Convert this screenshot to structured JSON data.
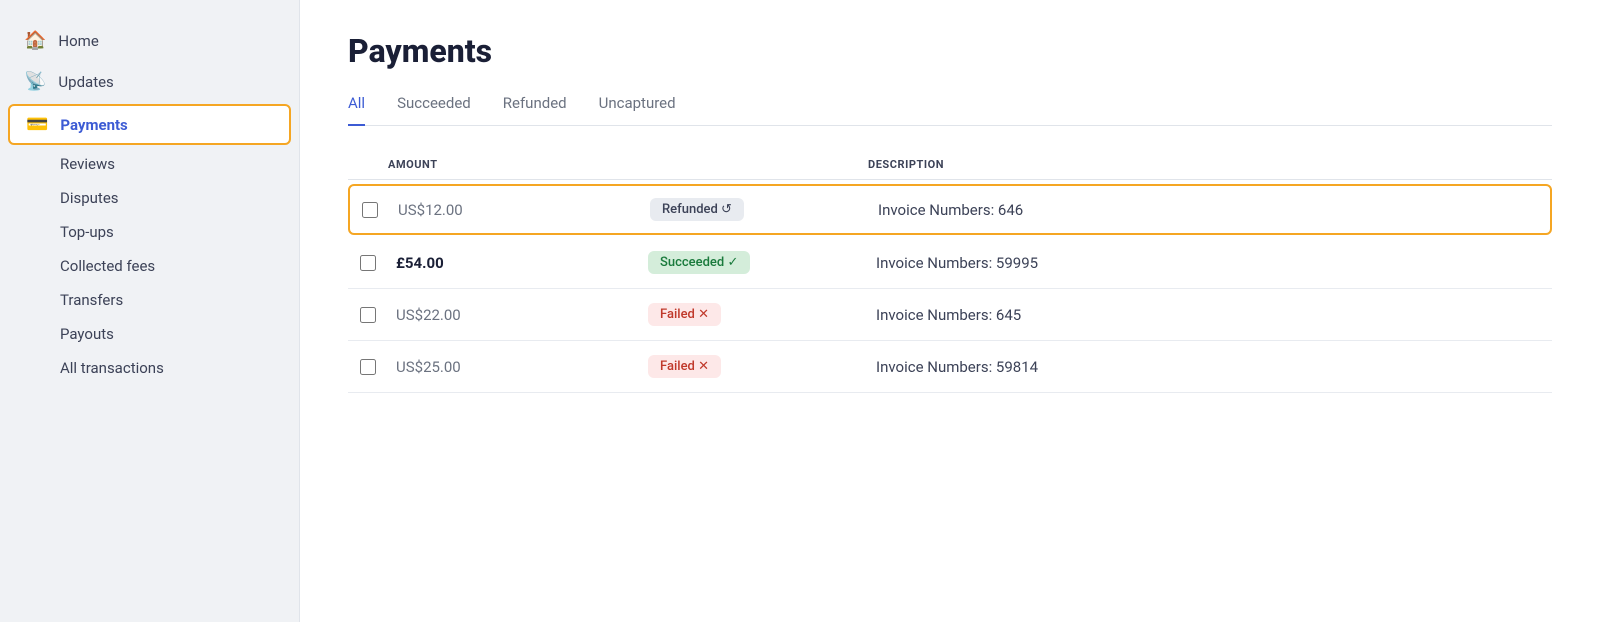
{
  "sidebar": {
    "items": [
      {
        "id": "home",
        "label": "Home",
        "icon": "🏠",
        "active": false,
        "sub": false
      },
      {
        "id": "updates",
        "label": "Updates",
        "icon": "📡",
        "active": false,
        "sub": false
      },
      {
        "id": "payments",
        "label": "Payments",
        "icon": "💳",
        "active": true,
        "sub": false
      },
      {
        "id": "reviews",
        "label": "Reviews",
        "icon": "",
        "active": false,
        "sub": true
      },
      {
        "id": "disputes",
        "label": "Disputes",
        "icon": "",
        "active": false,
        "sub": true
      },
      {
        "id": "topups",
        "label": "Top-ups",
        "icon": "",
        "active": false,
        "sub": true
      },
      {
        "id": "collected-fees",
        "label": "Collected fees",
        "icon": "",
        "active": false,
        "sub": true
      },
      {
        "id": "transfers",
        "label": "Transfers",
        "icon": "",
        "active": false,
        "sub": true
      },
      {
        "id": "payouts",
        "label": "Payouts",
        "icon": "",
        "active": false,
        "sub": true
      },
      {
        "id": "all-transactions",
        "label": "All transactions",
        "icon": "",
        "active": false,
        "sub": true
      }
    ]
  },
  "main": {
    "title": "Payments",
    "tabs": [
      {
        "id": "all",
        "label": "All",
        "active": true
      },
      {
        "id": "succeeded",
        "label": "Succeeded",
        "active": false
      },
      {
        "id": "refunded",
        "label": "Refunded",
        "active": false
      },
      {
        "id": "uncaptured",
        "label": "Uncaptured",
        "active": false
      }
    ],
    "table": {
      "columns": [
        {
          "id": "checkbox",
          "label": ""
        },
        {
          "id": "amount",
          "label": "AMOUNT"
        },
        {
          "id": "status",
          "label": ""
        },
        {
          "id": "description",
          "label": "DESCRIPTION"
        }
      ],
      "rows": [
        {
          "id": "row-1",
          "highlighted": true,
          "amount": "US$12.00",
          "amount_bold": false,
          "status": "Refunded",
          "status_type": "refunded",
          "status_icon": "↺",
          "description": "Invoice Numbers: 646"
        },
        {
          "id": "row-2",
          "highlighted": false,
          "amount": "£54.00",
          "amount_bold": true,
          "status": "Succeeded",
          "status_type": "succeeded",
          "status_icon": "✓",
          "description": "Invoice Numbers: 59995"
        },
        {
          "id": "row-3",
          "highlighted": false,
          "amount": "US$22.00",
          "amount_bold": false,
          "status": "Failed",
          "status_type": "failed",
          "status_icon": "✕",
          "description": "Invoice Numbers: 645"
        },
        {
          "id": "row-4",
          "highlighted": false,
          "amount": "US$25.00",
          "amount_bold": false,
          "status": "Failed",
          "status_type": "failed",
          "status_icon": "✕",
          "description": "Invoice Numbers: 59814"
        }
      ]
    }
  }
}
